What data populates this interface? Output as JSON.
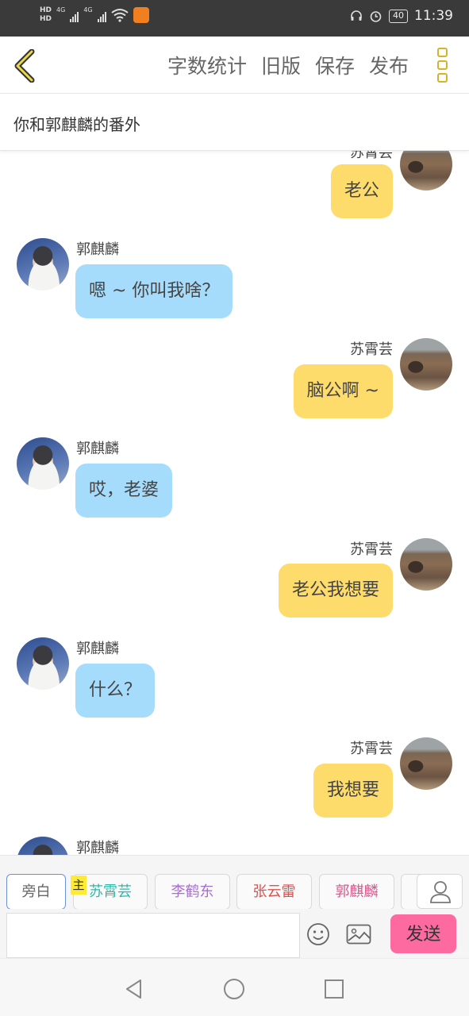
{
  "status_bar": {
    "hd1": "HD",
    "hd2": "HD",
    "net1": "4G",
    "net2": "4G",
    "battery": "40",
    "time": "11:39"
  },
  "header": {
    "actions": [
      "字数统计",
      "旧版",
      "保存",
      "发布"
    ],
    "menu_color": "#d6b42a"
  },
  "title": "你和郭麒麟的番外",
  "messages": [
    {
      "side": "right",
      "name": "苏霄芸",
      "text": "老公"
    },
    {
      "side": "left",
      "name": "郭麒麟",
      "text": "嗯 ~ 你叫我啥？"
    },
    {
      "side": "right",
      "name": "苏霄芸",
      "text": "脑公啊 ~"
    },
    {
      "side": "left",
      "name": "郭麒麟",
      "text": "哎，老婆"
    },
    {
      "side": "right",
      "name": "苏霄芸",
      "text": "老公我想要"
    },
    {
      "side": "left",
      "name": "郭麒麟",
      "text": "什么？"
    },
    {
      "side": "right",
      "name": "苏霄芸",
      "text": "我想要"
    },
    {
      "side": "left",
      "name": "郭麒麟",
      "text": ""
    }
  ],
  "roles": {
    "main_tag": "主",
    "items": [
      {
        "label": "旁白",
        "color": "#666666"
      },
      {
        "label": "苏霄芸",
        "color": "#2fb8a8"
      },
      {
        "label": "李鹤东",
        "color": "#a56fcf"
      },
      {
        "label": "张云雷",
        "color": "#d9534f"
      },
      {
        "label": "郭麒麟",
        "color": "#d6578c"
      }
    ]
  },
  "input": {
    "value": "",
    "placeholder": "",
    "send_label": "发送"
  },
  "colors": {
    "left_bubble": "#a6dcfb",
    "right_bubble": "#fedc6b",
    "send_button": "#fd6aa0"
  }
}
